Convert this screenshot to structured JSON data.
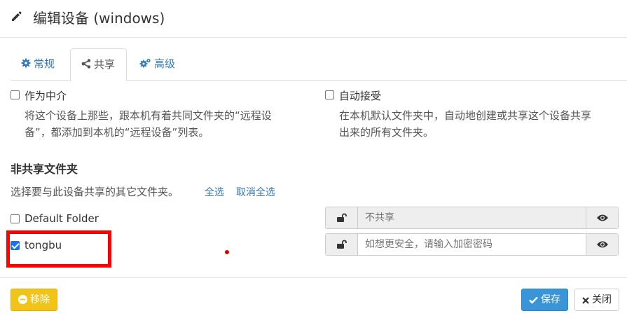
{
  "dialog": {
    "title": "编辑设备 (windows)",
    "title_icon": "pencil-icon"
  },
  "tabs": [
    {
      "label": "常规",
      "icon": "gear-icon",
      "active": false
    },
    {
      "label": "共享",
      "icon": "share-icon",
      "active": true
    },
    {
      "label": "高级",
      "icon": "gears-icon",
      "active": false
    }
  ],
  "introducer": {
    "label": "作为中介",
    "checked": false,
    "help_line1": "将这个设备上那些，跟本机有着共同文件夹的“远程设",
    "help_line2": "备”，都添加到本机的“远程设备”列表。"
  },
  "auto_accept": {
    "label": "自动接受",
    "checked": false,
    "help_line1": "在本机默认文件夹中，自动地创建或共享这个设备共享",
    "help_line2": "出来的所有文件夹。"
  },
  "unshared": {
    "section_title": "非共享文件夹",
    "hint": "选择要与此设备共享的其它文件夹。",
    "select_all": "全选",
    "deselect_all": "取消全选",
    "folders": [
      {
        "label": "Default Folder",
        "checked": false,
        "password_placeholder": "不共享",
        "disabled": true
      },
      {
        "label": "tongbu",
        "checked": true,
        "password_placeholder": "如想更安全，请输入加密密码",
        "disabled": false
      }
    ]
  },
  "footer": {
    "remove_label": "移除",
    "save_label": "保存",
    "close_label": "关闭"
  },
  "colors": {
    "link": "#337ab7",
    "primary": "#3a94d8",
    "warning": "#f0c419",
    "highlight": "#ff0000"
  }
}
